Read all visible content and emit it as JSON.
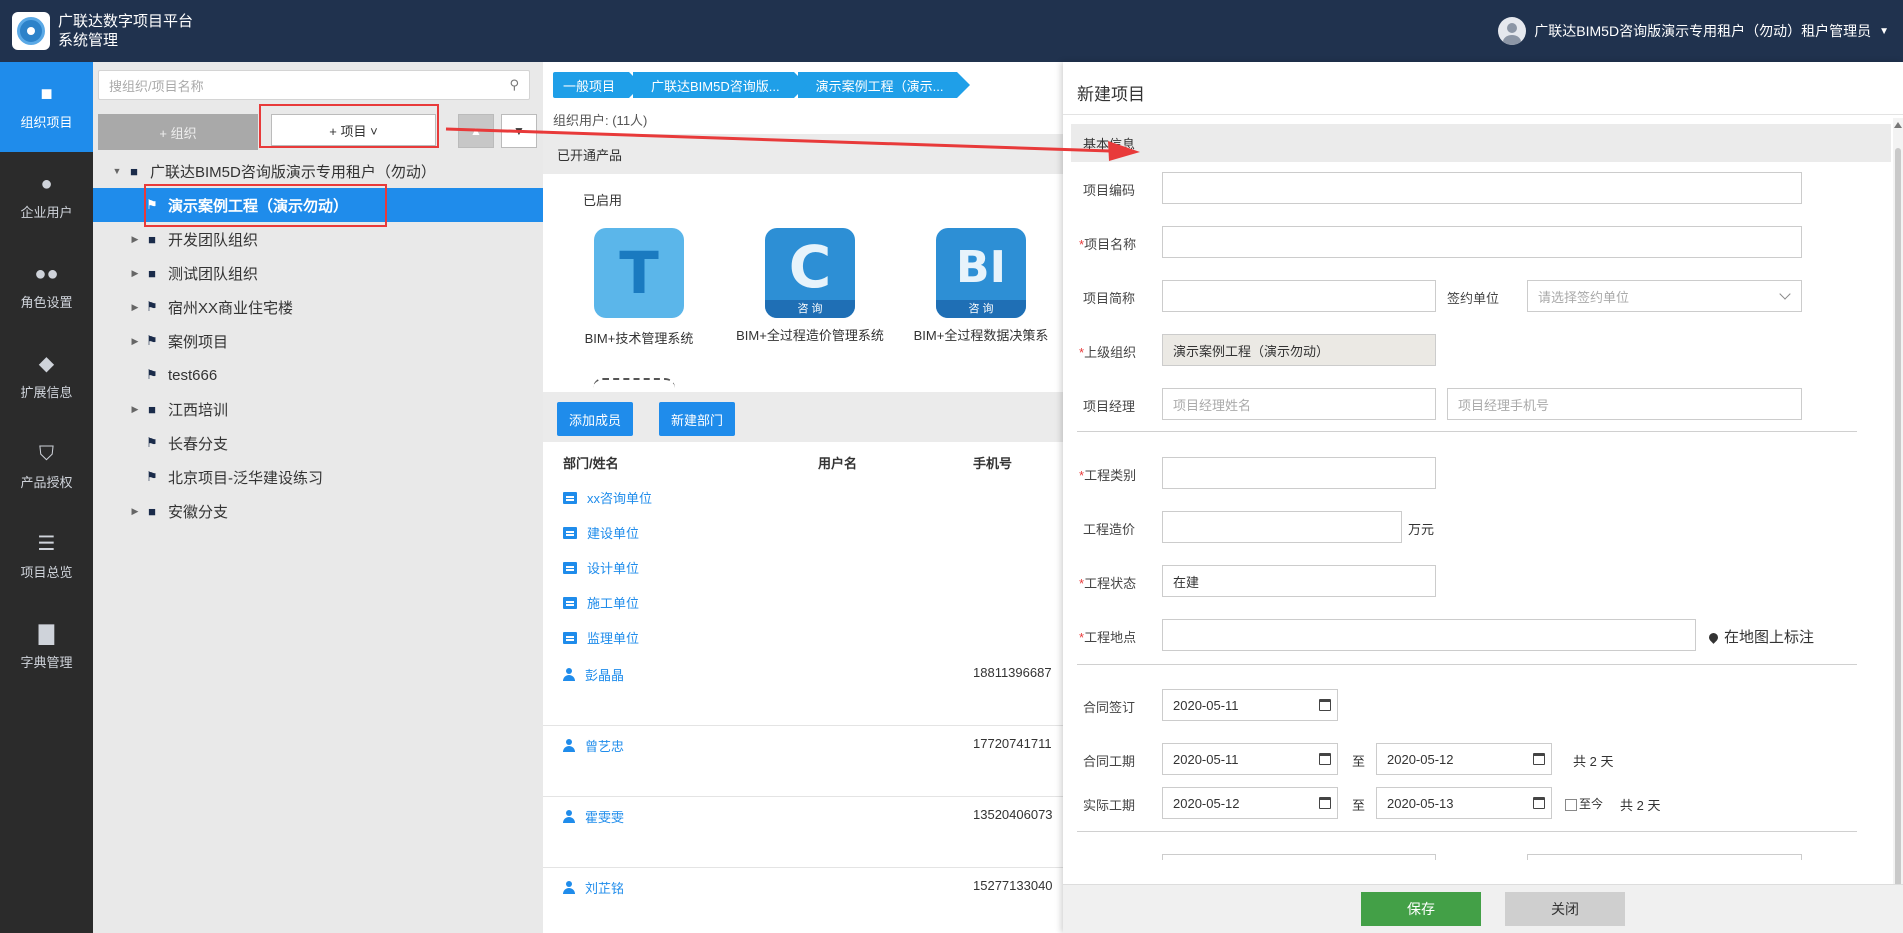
{
  "header": {
    "app_title_line1": "广联达数字项目平台",
    "app_title_line2": "系统管理",
    "user_label": "广联达BIM5D咨询版演示专用租户（勿动）租户管理员"
  },
  "sidenav": {
    "items": [
      {
        "label": "组织项目",
        "icon": "folder-icon"
      },
      {
        "label": "企业用户",
        "icon": "user-icon"
      },
      {
        "label": "角色设置",
        "icon": "group-icon"
      },
      {
        "label": "扩展信息",
        "icon": "tag-icon"
      },
      {
        "label": "产品授权",
        "icon": "shield-icon"
      },
      {
        "label": "项目总览",
        "icon": "list-icon"
      },
      {
        "label": "字典管理",
        "icon": "book-icon"
      }
    ]
  },
  "tree_panel": {
    "search_placeholder": "搜组织/项目名称",
    "add_org_label": "+ 组织",
    "add_project_label": "+ 项目 ˅",
    "items": [
      {
        "label": "广联达BIM5D咨询版演示专用租户（勿动）"
      },
      {
        "label": "演示案例工程（演示勿动）"
      },
      {
        "label": "开发团队组织"
      },
      {
        "label": "测试团队组织"
      },
      {
        "label": "宿州XX商业住宅楼"
      },
      {
        "label": "案例项目"
      },
      {
        "label": "test666"
      },
      {
        "label": "江西培训"
      },
      {
        "label": "长春分支"
      },
      {
        "label": "北京项目-泛华建设练习"
      },
      {
        "label": "安徽分支"
      }
    ]
  },
  "middle": {
    "breadcrumb": [
      "一般项目",
      "广联达BIM5D咨询版...",
      "演示案例工程（演示..."
    ],
    "org_users": "组织用户: (11人)",
    "opened_products": "已开通产品",
    "enabled": "已启用",
    "products": [
      {
        "name": "BIM+技术管理系统",
        "letter": "T",
        "badge": ""
      },
      {
        "name": "BIM+全过程造价管理系统",
        "letter": "C",
        "badge": "咨 询"
      },
      {
        "name": "BIM+全过程数据决策系",
        "letter": "BI",
        "badge": "咨 询"
      }
    ],
    "add_member": "添加成员",
    "new_department": "新建部门",
    "columns": {
      "dept_name": "部门/姓名",
      "username": "用户名",
      "phone": "手机号"
    },
    "departments": [
      "xx咨询单位",
      "建设单位",
      "设计单位",
      "施工单位",
      "监理单位"
    ],
    "users": [
      {
        "name": "彭晶晶",
        "phone": "18811396687"
      },
      {
        "name": "曾艺忠",
        "phone": "17720741711"
      },
      {
        "name": "霍雯雯",
        "phone": "13520406073"
      },
      {
        "name": "刘芷铭",
        "phone": "15277133040"
      }
    ]
  },
  "dialog": {
    "title": "新建项目",
    "section_basic": "基本信息",
    "labels": {
      "project_code": "项目编码",
      "project_name": "项目名称",
      "project_short": "项目简称",
      "contract_unit": "签约单位",
      "parent_org": "上级组织",
      "project_manager": "项目经理",
      "eng_type": "工程类别",
      "eng_cost": "工程造价",
      "eng_status": "工程状态",
      "eng_location": "工程地点",
      "contract_sign": "合同签订",
      "contract_period": "合同工期",
      "actual_period": "实际工期"
    },
    "required_mark": "*",
    "contract_unit_placeholder": "请选择签约单位",
    "parent_org_value": "演示案例工程（演示勿动）",
    "pm_name_placeholder": "项目经理姓名",
    "pm_phone_placeholder": "项目经理手机号",
    "cost_unit": "万元",
    "status_value": "在建",
    "map_mark": "在地图上标注",
    "sign_date": "2020-05-11",
    "contract_start": "2020-05-11",
    "contract_end": "2020-05-12",
    "contract_total": "共 2 天",
    "actual_start": "2020-05-12",
    "actual_end": "2020-05-13",
    "until_now": "至今",
    "actual_total": "共 2 天",
    "to": "至",
    "save": "保存",
    "close": "关闭"
  }
}
